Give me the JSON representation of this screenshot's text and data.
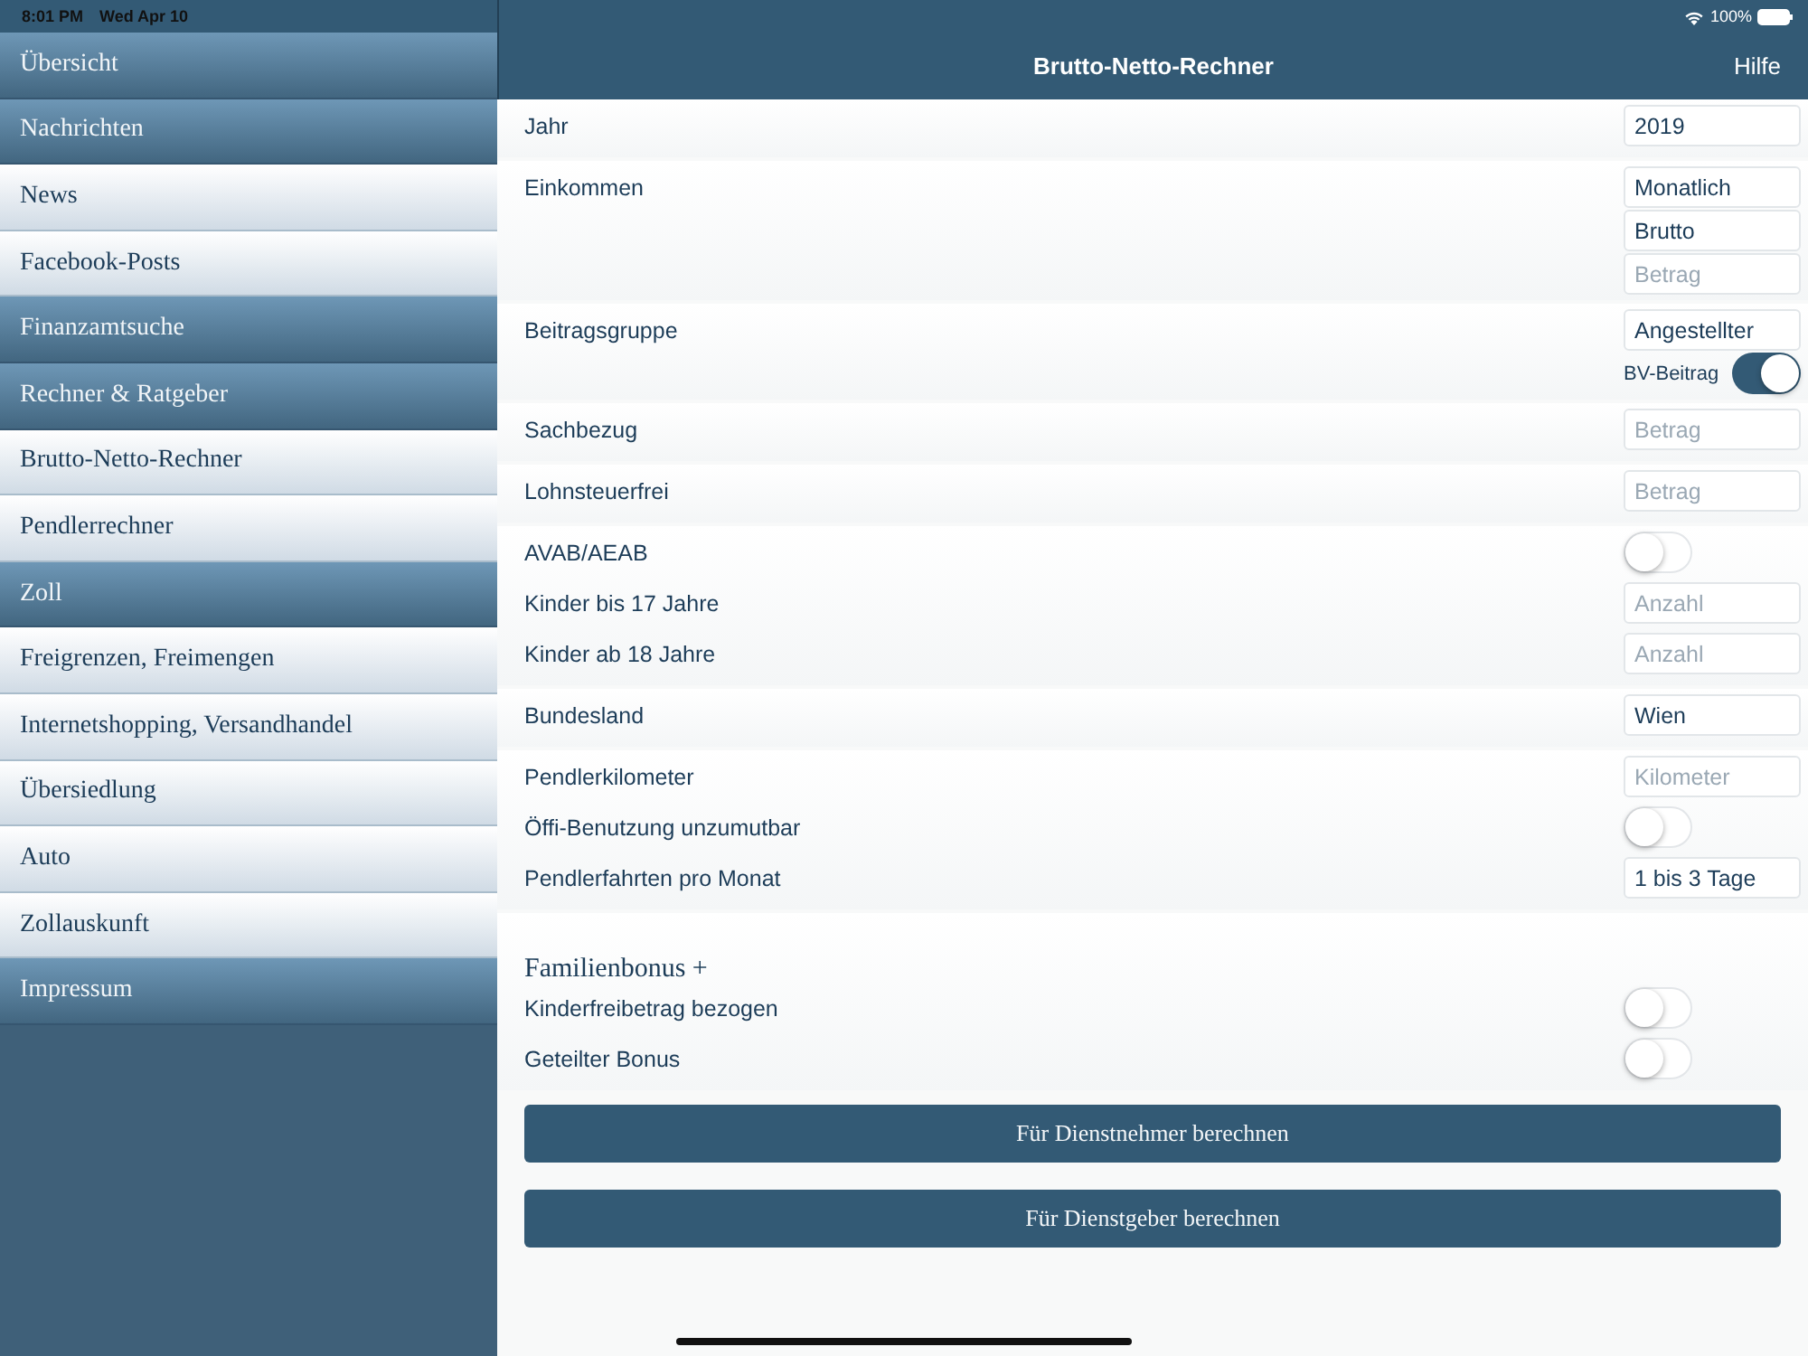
{
  "status_bar": {
    "time": "8:01 PM",
    "date": "Wed Apr 10",
    "battery": "100%"
  },
  "sidebar": {
    "items": [
      {
        "label": "Übersicht",
        "kind": "section"
      },
      {
        "label": "Nachrichten",
        "kind": "section"
      },
      {
        "label": "News",
        "kind": "link"
      },
      {
        "label": "Facebook-Posts",
        "kind": "link"
      },
      {
        "label": "Finanzamtsuche",
        "kind": "section"
      },
      {
        "label": "Rechner & Ratgeber",
        "kind": "section"
      },
      {
        "label": "Brutto-Netto-Rechner",
        "kind": "link"
      },
      {
        "label": "Pendlerrechner",
        "kind": "link"
      },
      {
        "label": "Zoll",
        "kind": "section"
      },
      {
        "label": "Freigrenzen, Freimengen",
        "kind": "link"
      },
      {
        "label": "Internetshopping, Versandhandel",
        "kind": "link"
      },
      {
        "label": "Übersiedlung",
        "kind": "link"
      },
      {
        "label": "Auto",
        "kind": "link"
      },
      {
        "label": "Zollauskunft",
        "kind": "link"
      },
      {
        "label": "Impressum",
        "kind": "section"
      }
    ]
  },
  "header": {
    "title": "Brutto-Netto-Rechner",
    "help": "Hilfe"
  },
  "form": {
    "groups": [
      {
        "rows": [
          {
            "kind": "input",
            "label": "Jahr",
            "controls": [
              {
                "kind": "field",
                "value": "2019"
              }
            ]
          }
        ]
      },
      {
        "rows": [
          {
            "kind": "input",
            "label": "Einkommen",
            "controls": [
              {
                "kind": "field",
                "value": "Monatlich"
              },
              {
                "kind": "field",
                "value": "Brutto"
              },
              {
                "kind": "field",
                "placeholder": "Betrag"
              }
            ]
          }
        ]
      },
      {
        "rows": [
          {
            "kind": "input",
            "label": "Beitragsgruppe",
            "controls": [
              {
                "kind": "field",
                "value": "Angestellter"
              },
              {
                "kind": "toggle",
                "label": "BV-Beitrag",
                "on": true
              }
            ]
          }
        ]
      },
      {
        "rows": [
          {
            "kind": "input",
            "label": "Sachbezug",
            "controls": [
              {
                "kind": "field",
                "placeholder": "Betrag"
              }
            ]
          }
        ]
      },
      {
        "rows": [
          {
            "kind": "input",
            "label": "Lohnsteuerfrei",
            "controls": [
              {
                "kind": "field",
                "placeholder": "Betrag"
              }
            ]
          }
        ]
      },
      {
        "rows": [
          {
            "kind": "input",
            "label": "AVAB/AEAB",
            "controls": [
              {
                "kind": "toggle",
                "on": false
              }
            ]
          },
          {
            "kind": "input",
            "label": "Kinder bis 17 Jahre",
            "controls": [
              {
                "kind": "field",
                "placeholder": "Anzahl"
              }
            ]
          },
          {
            "kind": "input",
            "label": "Kinder ab 18 Jahre",
            "controls": [
              {
                "kind": "field",
                "placeholder": "Anzahl"
              }
            ]
          }
        ]
      },
      {
        "rows": [
          {
            "kind": "input",
            "label": "Bundesland",
            "controls": [
              {
                "kind": "field",
                "value": "Wien"
              }
            ]
          }
        ]
      },
      {
        "rows": [
          {
            "kind": "input",
            "label": "Pendlerkilometer",
            "controls": [
              {
                "kind": "field",
                "placeholder": "Kilometer"
              }
            ]
          },
          {
            "kind": "input",
            "label": "Öffi-Benutzung unzumutbar",
            "controls": [
              {
                "kind": "toggle",
                "on": false
              }
            ]
          },
          {
            "kind": "input",
            "label": "Pendlerfahrten pro Monat",
            "controls": [
              {
                "kind": "field",
                "value": "1 bis 3 Tage"
              }
            ]
          }
        ]
      },
      {
        "rows": [
          {
            "kind": "heading",
            "label": "Familienbonus +"
          },
          {
            "kind": "input",
            "label": "Kinderfreibetrag bezogen",
            "controls": [
              {
                "kind": "toggle",
                "on": false
              }
            ]
          },
          {
            "kind": "input",
            "label": "Geteilter Bonus",
            "controls": [
              {
                "kind": "toggle",
                "on": false
              }
            ]
          }
        ]
      }
    ]
  },
  "buttons": [
    "Für Dienstnehmer berechnen",
    "Für Dienstgeber berechnen"
  ]
}
